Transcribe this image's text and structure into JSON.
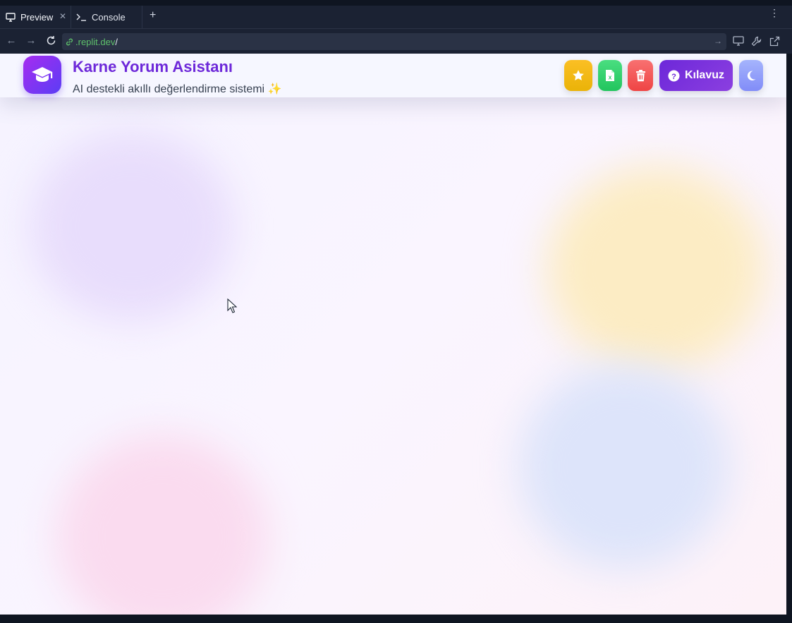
{
  "tabs": [
    {
      "label": "Preview",
      "icon": "monitor-icon",
      "active": true
    },
    {
      "label": "Console",
      "icon": "terminal-icon",
      "active": false
    }
  ],
  "new_tab_label": "+",
  "url": {
    "host": ".replit.dev",
    "path": "/"
  },
  "app": {
    "title": "Karne Yorum Asistanı",
    "subtitle": "AI destekli akıllı değerlendirme sistemi",
    "subtitle_emoji": "✨",
    "logo_icon": "graduation-cap-icon",
    "buttons": {
      "favorites_icon": "star-icon",
      "excel_icon": "excel-file-icon",
      "clear_icon": "trash-icon",
      "guide_label": "Kılavuz",
      "guide_icon": "question-circle-icon",
      "theme_icon": "moon-icon"
    },
    "colors": {
      "title": "#6d28d9",
      "star": "#eab308",
      "excel": "#22c55e",
      "clear": "#ef4444",
      "guide": "#6d28d9",
      "theme": "#818cf8"
    }
  }
}
